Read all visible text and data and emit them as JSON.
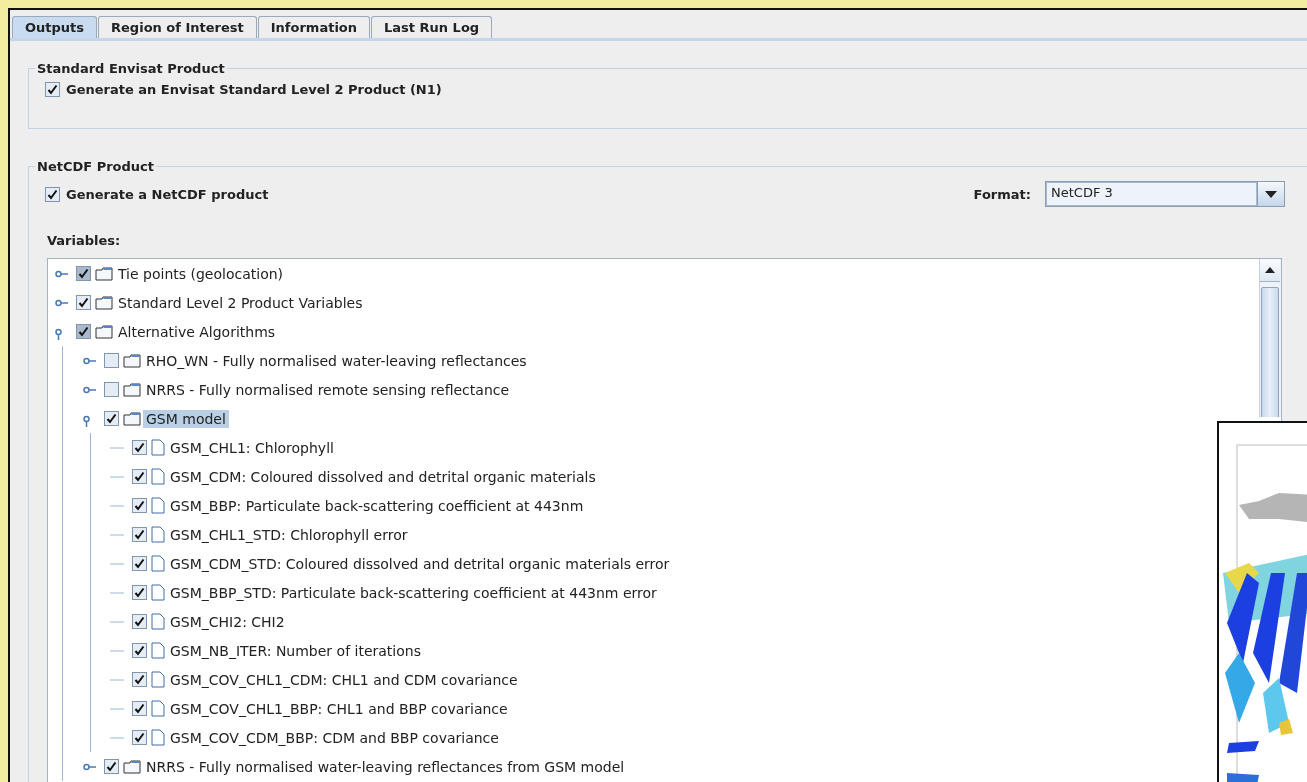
{
  "tabs": [
    {
      "label": "Outputs",
      "selected": true
    },
    {
      "label": "Region of Interest",
      "selected": false
    },
    {
      "label": "Information",
      "selected": false
    },
    {
      "label": "Last Run Log",
      "selected": false
    }
  ],
  "standard_product": {
    "title": "Standard Envisat Product",
    "checkbox": {
      "label": "Generate an Envisat Standard Level 2 Product (N1)",
      "checked": true
    }
  },
  "netcdf_product": {
    "title": "NetCDF Product",
    "checkbox": {
      "label": "Generate a NetCDF product",
      "checked": true
    },
    "format": {
      "label": "Format:",
      "value": "NetCDF 3"
    },
    "variables_label": "Variables:",
    "tree": [
      {
        "kind": "folder",
        "label": "Tie points (geolocation)",
        "checked": true,
        "partial": true,
        "expanded": false,
        "selected": false
      },
      {
        "kind": "folder",
        "label": "Standard Level 2 Product Variables",
        "checked": true,
        "partial": false,
        "expanded": false,
        "selected": false
      },
      {
        "kind": "folder",
        "label": "Alternative Algorithms",
        "checked": true,
        "partial": true,
        "expanded": true,
        "selected": false,
        "children": [
          {
            "kind": "folder",
            "label": "RHO_WN - Fully normalised water-leaving reflectances",
            "checked": false,
            "partial": false,
            "expanded": false,
            "selected": false
          },
          {
            "kind": "folder",
            "label": "NRRS - Fully normalised remote sensing reflectance",
            "checked": false,
            "partial": false,
            "expanded": false,
            "selected": false
          },
          {
            "kind": "folder",
            "label": "GSM model",
            "checked": true,
            "partial": false,
            "expanded": true,
            "selected": true,
            "children": [
              {
                "kind": "file",
                "label": "GSM_CHL1: Chlorophyll",
                "checked": true,
                "selected": false
              },
              {
                "kind": "file",
                "label": "GSM_CDM: Coloured dissolved and detrital organic materials",
                "checked": true,
                "selected": false
              },
              {
                "kind": "file",
                "label": "GSM_BBP: Particulate back-scattering coefficient at 443nm",
                "checked": true,
                "selected": false
              },
              {
                "kind": "file",
                "label": "GSM_CHL1_STD: Chlorophyll error",
                "checked": true,
                "selected": false
              },
              {
                "kind": "file",
                "label": "GSM_CDM_STD: Coloured dissolved and detrital organic materials error",
                "checked": true,
                "selected": false
              },
              {
                "kind": "file",
                "label": "GSM_BBP_STD: Particulate back-scattering coefficient at 443nm error",
                "checked": true,
                "selected": false
              },
              {
                "kind": "file",
                "label": "GSM_CHI2: CHI2",
                "checked": true,
                "selected": false
              },
              {
                "kind": "file",
                "label": "GSM_NB_ITER: Number of iterations",
                "checked": true,
                "selected": false
              },
              {
                "kind": "file",
                "label": "GSM_COV_CHL1_CDM: CHL1 and CDM covariance",
                "checked": true,
                "selected": false
              },
              {
                "kind": "file",
                "label": "GSM_COV_CHL1_BBP: CHL1 and BBP covariance",
                "checked": true,
                "selected": false
              },
              {
                "kind": "file",
                "label": "GSM_COV_CDM_BBP: CDM and BBP covariance",
                "checked": true,
                "selected": false
              }
            ]
          },
          {
            "kind": "folder",
            "label": "NRRS - Fully normalised water-leaving reflectances from GSM model",
            "checked": true,
            "partial": false,
            "expanded": false,
            "selected": false
          }
        ]
      }
    ]
  }
}
